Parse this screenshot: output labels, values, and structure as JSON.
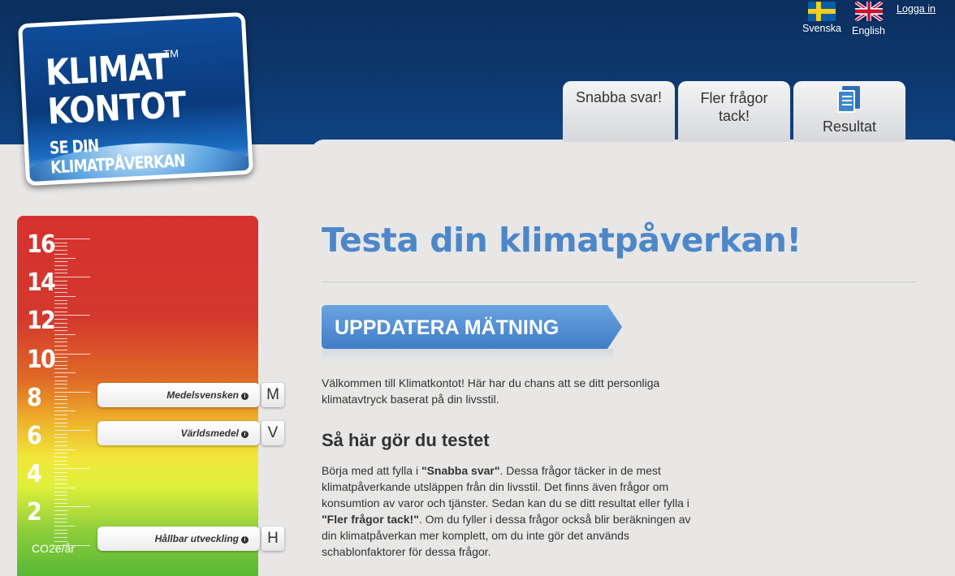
{
  "logo": {
    "line1": "KLIMAT",
    "tm": "TM",
    "line2": "KONTOT",
    "line3": "SE DIN KLIMATPÅVERKAN"
  },
  "languages": [
    {
      "label": "Svenska"
    },
    {
      "label": "English"
    }
  ],
  "login": "Logga in",
  "tabs": [
    {
      "label": "Snabba svar!"
    },
    {
      "label": "Fler frågor tack!"
    },
    {
      "label": "Resultat"
    }
  ],
  "meter": {
    "scale": [
      "16",
      "14",
      "12",
      "10",
      "8",
      "6",
      "4",
      "2"
    ],
    "unit": "CO2e/år",
    "markers": [
      {
        "label": "Medelsvensken",
        "letter": "M",
        "value": 8
      },
      {
        "label": "Världsmedel",
        "letter": "V",
        "value": 6
      },
      {
        "label": "Hållbar utveckling",
        "letter": "H",
        "value": 0.5
      }
    ],
    "info_glyph": "i",
    "colors": {
      "top": "#d6312f",
      "middle": "#f2e63a",
      "bottom": "#4fb534"
    }
  },
  "main": {
    "title": "Testa din klimatpåverkan!",
    "cta": "UPPDATERA MÄTNING",
    "intro": "Välkommen till Klimatkontot! Här har du chans att se ditt personliga klimatavtryck baserat på din livsstil.",
    "howto_heading": "Så här gör du testet",
    "howto": {
      "t1": "Börja med att fylla i ",
      "b1": "\"Snabba svar\"",
      "t2": ". Dessa frågor täcker in de mest klimatpåverkande utsläppen från din livsstil. Det finns även frågor om konsumtion av varor och tjänster. Sedan kan du se ditt resultat eller fylla i ",
      "b2": "\"Fler frågor tack!\"",
      "t3": ". Om du fyller i dessa frågor också blir beräkningen av din klimatpåverkan mer komplett, om du inte gör det används schablonfaktorer för dessa frågor."
    }
  },
  "colors": {
    "header": "#0b2f5e",
    "accent": "#4d87c9",
    "panel": "#e8e7e6"
  }
}
